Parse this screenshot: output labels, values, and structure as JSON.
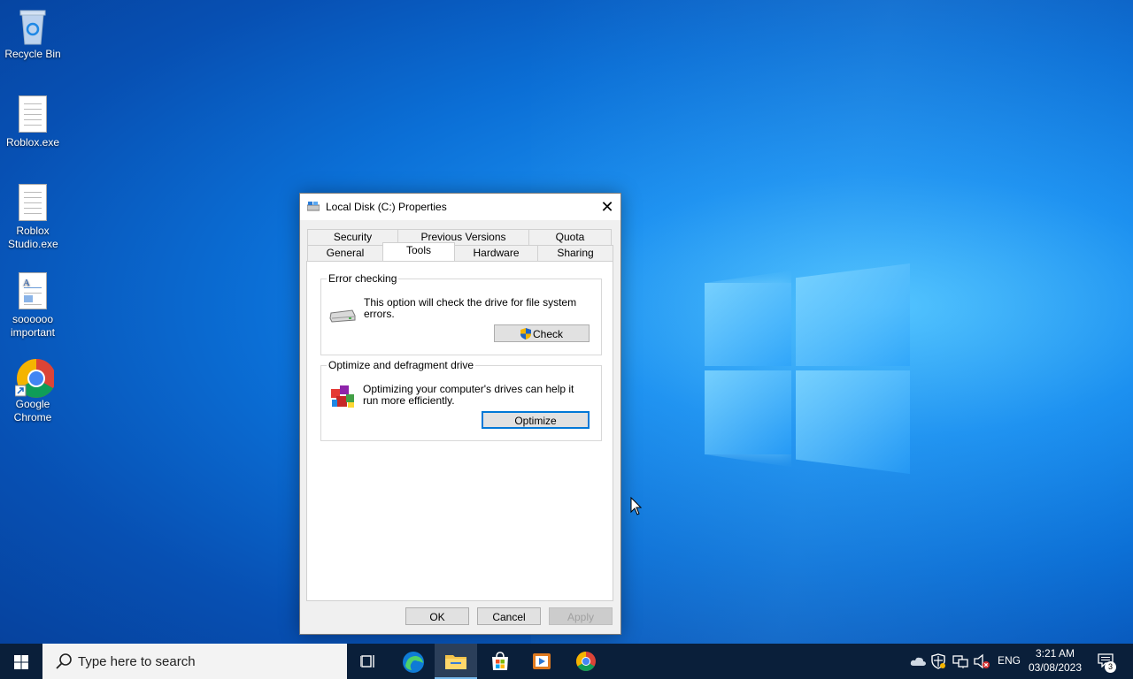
{
  "desktop": {
    "icons": [
      {
        "label": "Recycle Bin",
        "icon": "recycle-bin-icon"
      },
      {
        "label": "Roblox.exe",
        "icon": "file-icon"
      },
      {
        "label": "Roblox Studio.exe",
        "icon": "file-icon"
      },
      {
        "label": "soooooo important",
        "icon": "document-icon"
      },
      {
        "label": "Google Chrome",
        "icon": "chrome-icon"
      }
    ]
  },
  "dialog": {
    "title": "Local Disk (C:) Properties",
    "tabs_row1": [
      "Security",
      "Previous Versions",
      "Quota"
    ],
    "tabs_row2": [
      "General",
      "Tools",
      "Hardware",
      "Sharing"
    ],
    "active_tab": "Tools",
    "error_checking": {
      "legend": "Error checking",
      "description": "This option will check the drive for file system errors.",
      "button": "Check"
    },
    "optimize": {
      "legend": "Optimize and defragment drive",
      "description": "Optimizing your computer's drives can help it run more efficiently.",
      "button": "Optimize"
    },
    "footer": {
      "ok": "OK",
      "cancel": "Cancel",
      "apply": "Apply"
    }
  },
  "taskbar": {
    "search_placeholder": "Type here to search",
    "language": "ENG",
    "time": "3:21 AM",
    "date": "03/08/2023",
    "notifications_count": "3"
  },
  "colors": {
    "accent": "#0078d7",
    "taskbar": "#0a1f3a"
  }
}
